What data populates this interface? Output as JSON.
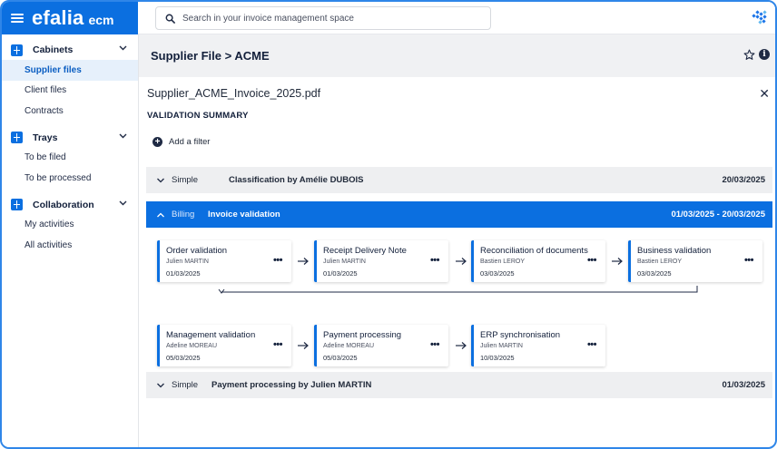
{
  "app": {
    "logo_main": "efalia",
    "logo_sub": "ecm",
    "icons": {
      "menu": "hamburger-menu-icon",
      "brand": "efalia-brand-icon"
    }
  },
  "search": {
    "placeholder": "Search in your invoice management space",
    "value": ""
  },
  "sidebar": {
    "sections": [
      {
        "title": "Cabinets",
        "items": [
          "Supplier files",
          "Client files",
          "Contracts"
        ]
      },
      {
        "title": "Trays",
        "items": [
          "To be filed",
          "To be processed"
        ]
      },
      {
        "title": "Collaboration",
        "items": [
          "My activities",
          "All activities"
        ]
      }
    ],
    "active_item": "Supplier files"
  },
  "header": {
    "title": "Supplier File > ACME"
  },
  "document": {
    "filename": "Supplier_ACME_Invoice_2025.pdf",
    "section_label": "VALIDATION SUMMARY",
    "add_filter_label": "Add a filter"
  },
  "workflows": [
    {
      "type": "Simple",
      "name": "Classification by Amélie DUBOIS",
      "date": "20/03/2025",
      "expanded": false
    },
    {
      "type": "Billing",
      "name": "Invoice validation",
      "date": "01/03/2025 - 20/03/2025",
      "expanded": true
    },
    {
      "type": "Simple",
      "name": "Payment processing by Julien MARTIN",
      "date": "01/03/2025",
      "expanded": false
    }
  ],
  "steps": [
    {
      "title": "Order validation",
      "user": "Julien MARTIN",
      "date": "01/03/2025"
    },
    {
      "title": "Receipt Delivery Note",
      "user": "Julien MARTIN",
      "date": "01/03/2025"
    },
    {
      "title": "Reconciliation of documents",
      "user": "Bastien LEROY",
      "date": "03/03/2025"
    },
    {
      "title": "Business validation",
      "user": "Bastien LEROY",
      "date": "03/03/2025"
    },
    {
      "title": "Management validation",
      "user": "Adeline MOREAU",
      "date": "05/03/2025"
    },
    {
      "title": "Payment processing",
      "user": "Adeline MOREAU",
      "date": "05/03/2025"
    },
    {
      "title": "ERP synchronisation",
      "user": "Julien MARTIN",
      "date": "10/03/2025"
    }
  ],
  "more_label": "•••",
  "colors": {
    "primary": "#0b6fe0",
    "active_bg": "#e6f0fb",
    "row_bg": "#eeeff1"
  }
}
